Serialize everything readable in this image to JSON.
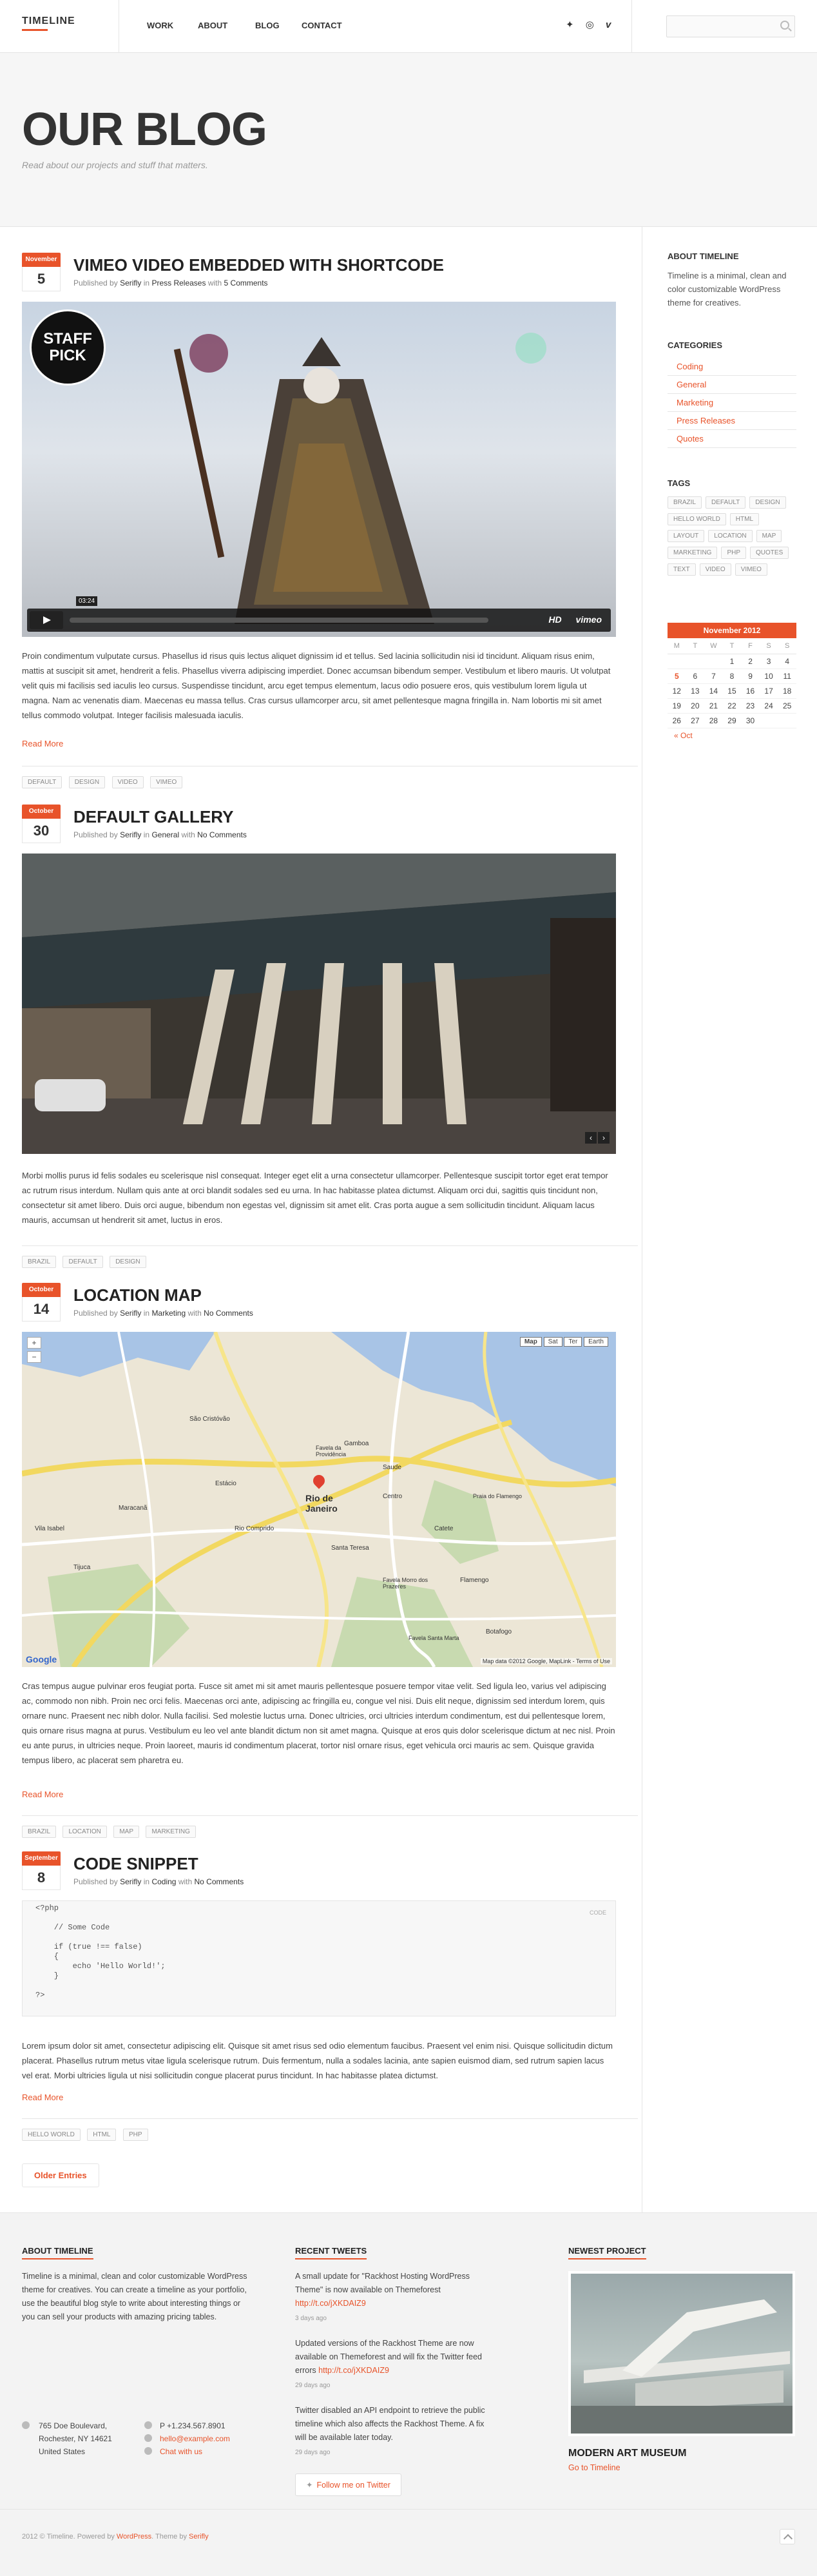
{
  "header": {
    "logo": "TIMELINE",
    "nav": [
      "WORK",
      "ABOUT",
      "BLOG",
      "CONTACT"
    ],
    "social_icons": [
      "twitter-icon",
      "dribbble-icon",
      "vimeo-icon"
    ],
    "social_glyphs": [
      "✦",
      "◎",
      "v"
    ],
    "search_placeholder": "",
    "accent_color": "#e8532a"
  },
  "hero": {
    "title": "OUR BLOG",
    "subtitle": "Read about our projects and stuff that matters."
  },
  "posts": [
    {
      "month": "November",
      "day": "5",
      "title": "VIMEO VIDEO EMBEDDED WITH SHORTCODE",
      "meta_prefix": "Published by",
      "author": "Serifly",
      "in": "in",
      "category": "Press Releases",
      "with": "with",
      "comments": "5 Comments",
      "video_time": "03:24",
      "video_hd": "HD",
      "video_brand": "vimeo",
      "badge_text": "STAFF PICK",
      "text": "Proin condimentum vulputate cursus. Phasellus id risus quis lectus aliquet dignissim id et tellus. Sed lacinia sollicitudin nisi id tincidunt. Aliquam risus enim, mattis at suscipit sit amet, hendrerit a felis. Phasellus viverra adipiscing imperdiet. Donec accumsan bibendum semper. Vestibulum et libero mauris. Ut volutpat velit quis mi facilisis sed iaculis leo cursus. Suspendisse tincidunt, arcu eget tempus elementum, lacus odio posuere eros, quis vestibulum lorem ligula ut magna. Nam ac venenatis diam. Maecenas eu massa tellus. Cras cursus ullamcorper arcu, sit amet pellentesque magna fringilla in. Nam lobortis mi sit amet tellus commodo volutpat. Integer facilisis malesuada iaculis.",
      "read_more": "Read More",
      "tags": [
        "DEFAULT",
        "DESIGN",
        "VIDEO",
        "VIMEO"
      ]
    },
    {
      "month": "October",
      "day": "30",
      "title": "DEFAULT GALLERY",
      "meta_prefix": "Published by",
      "author": "Serifly",
      "in": "in",
      "category": "General",
      "with": "with",
      "comments": "No Comments",
      "text": "Morbi mollis purus id felis sodales eu scelerisque nisl consequat. Integer eget elit a urna consectetur ullamcorper. Pellentesque suscipit tortor eget erat tempor ac rutrum risus interdum. Nullam quis ante at orci blandit sodales sed eu urna. In hac habitasse platea dictumst. Aliquam orci dui, sagittis quis tincidunt non, consectetur sit amet libero. Duis orci augue, bibendum non egestas vel, dignissim sit amet elit. Cras porta augue a sem sollicitudin tincidunt. Aliquam lacus mauris, accumsan ut hendrerit sit amet, luctus in eros.",
      "tags": [
        "BRAZIL",
        "DEFAULT",
        "DESIGN"
      ]
    },
    {
      "month": "October",
      "day": "14",
      "title": "LOCATION MAP",
      "meta_prefix": "Published by",
      "author": "Serifly",
      "in": "in",
      "category": "Marketing",
      "with": "with",
      "comments": "No Comments",
      "map_buttons": [
        "Map",
        "Sat",
        "Ter",
        "Earth"
      ],
      "map_city": "Rio de Janeiro",
      "map_labels": [
        "Gamboa",
        "Saude",
        "Favela da Providência",
        "Centro",
        "Maracanã",
        "Tijuca",
        "Vila Isabel",
        "Santa Teresa",
        "Catete",
        "Flamengo",
        "Botafogo",
        "Praia do Flamengo",
        "Estácio",
        "São Cristóvão",
        "Rio Comprido",
        "Favela Morro dos Prazeres",
        "Favela Santa Marta"
      ],
      "map_footer": "Map data ©2012 Google, MapLink - Terms of Use",
      "map_logo": "Google",
      "text": "Cras tempus augue pulvinar eros feugiat porta. Fusce sit amet mi sit amet mauris pellentesque posuere tempor vitae velit. Sed ligula leo, varius vel adipiscing ac, commodo non nibh. Proin nec orci felis. Maecenas orci ante, adipiscing ac fringilla eu, congue vel nisi. Duis elit neque, dignissim sed interdum lorem, quis ornare nunc. Praesent nec nibh dolor. Nulla facilisi. Sed molestie luctus urna. Donec ultricies, orci ultricies interdum condimentum, est dui pellentesque lorem, quis ornare risus magna at purus. Vestibulum eu leo vel ante blandit dictum non sit amet magna. Quisque at eros quis dolor scelerisque dictum at nec nisl. Proin eu ante purus, in ultricies neque. Proin laoreet, mauris id condimentum placerat, tortor nisl ornare risus, eget vehicula orci mauris ac sem. Quisque gravida tempus libero, ac placerat sem pharetra eu.",
      "read_more": "Read More",
      "tags": [
        "BRAZIL",
        "LOCATION",
        "MAP",
        "MARKETING"
      ]
    },
    {
      "month": "September",
      "day": "8",
      "title": "CODE SNIPPET",
      "meta_prefix": "Published by",
      "author": "Serifly",
      "in": "in",
      "category": "Coding",
      "with": "with",
      "comments": "No Comments",
      "code_label": "CODE",
      "code": "<?php\n\n    // Some Code\n\n    if (true !== false)\n    {\n        echo 'Hello World!';\n    }\n\n?>",
      "text": "Lorem ipsum dolor sit amet, consectetur adipiscing elit. Quisque sit amet risus sed odio elementum faucibus. Praesent vel enim nisi. Quisque sollicitudin dictum placerat. Phasellus rutrum metus vitae ligula scelerisque rutrum. Duis fermentum, nulla a sodales lacinia, ante sapien euismod diam, sed rutrum sapien lacus vel erat. Morbi ultricies ligula ut nisi sollicitudin congue placerat purus tincidunt. In hac habitasse platea dictumst.",
      "read_more": "Read More",
      "tags": [
        "HELLO WORLD",
        "HTML",
        "PHP"
      ]
    }
  ],
  "older_entries": "Older Entries",
  "sidebar": {
    "about_title": "ABOUT TIMELINE",
    "about_text": "Timeline is a minimal, clean and color customizable WordPress theme for creatives.",
    "categories_title": "CATEGORIES",
    "categories": [
      "Coding",
      "General",
      "Marketing",
      "Press Releases",
      "Quotes"
    ],
    "tags_title": "TAGS",
    "tags": [
      "BRAZIL",
      "DEFAULT",
      "DESIGN",
      "HELLO WORLD",
      "HTML",
      "LAYOUT",
      "LOCATION",
      "MAP",
      "MARKETING",
      "PHP",
      "QUOTES",
      "TEXT",
      "VIDEO",
      "VIMEO"
    ],
    "calendar": {
      "month": "November 2012",
      "days": [
        "M",
        "T",
        "W",
        "T",
        "F",
        "S",
        "S"
      ],
      "weeks": [
        [
          "",
          "",
          "",
          "1",
          "2",
          "3",
          "4"
        ],
        [
          "5",
          "6",
          "7",
          "8",
          "9",
          "10",
          "11"
        ],
        [
          "12",
          "13",
          "14",
          "15",
          "16",
          "17",
          "18"
        ],
        [
          "19",
          "20",
          "21",
          "22",
          "23",
          "24",
          "25"
        ],
        [
          "26",
          "27",
          "28",
          "29",
          "30",
          "",
          ""
        ]
      ],
      "linked_day": "5",
      "prev": "« Oct"
    }
  },
  "footer": {
    "about_title": "ABOUT TIMELINE",
    "about_text": "Timeline is a minimal, clean and color customizable WordPress theme for creatives. You can create a timeline as your portfolio, use the beautiful blog style to write about interesting things or you can sell your products with amazing pricing tables.",
    "address": [
      "765 Doe Boulevard,",
      "Rochester, NY 14621",
      "United States"
    ],
    "phone": "P +1.234.567.8901",
    "email": "hello@example.com",
    "chat": "Chat with us",
    "tweets_title": "RECENT TWEETS",
    "tweets": [
      {
        "text": "A small update for \"Rackhost Hosting WordPress Theme\" is now available on Themeforest",
        "link": "http://t.co/jXKDAIZ9",
        "time": "3 days ago"
      },
      {
        "text": "Updated versions of the Rackhost Theme are now available on Themeforest and will fix the Twitter feed errors",
        "link": "http://t.co/jXKDAIZ9",
        "time": "29 days ago"
      },
      {
        "text": "Twitter disabled an API endpoint to retrieve the public timeline which also affects the Rackhost Theme. A fix will be available later today.",
        "link": "",
        "time": "29 days ago"
      }
    ],
    "follow": "Follow me on Twitter",
    "project_title": "NEWEST PROJECT",
    "project_name": "MODERN ART MUSEUM",
    "project_link": "Go to Timeline"
  },
  "copyright": {
    "prefix": "2012 © Timeline. Powered by",
    "wordpress": "WordPress",
    "mid": ". Theme by",
    "serifly": "Serifly"
  }
}
